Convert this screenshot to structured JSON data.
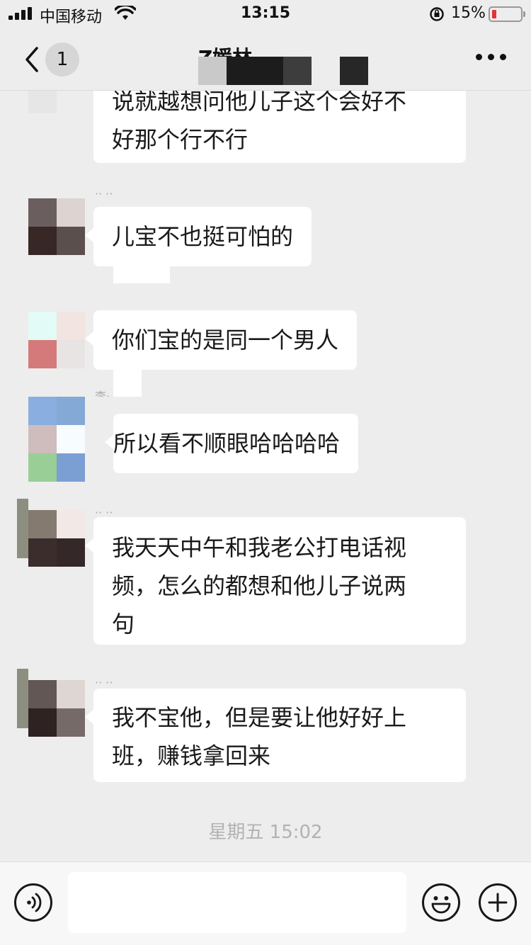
{
  "status_bar": {
    "carrier": "中国移动",
    "time": "13:15",
    "battery_percent": "15%",
    "battery_level": 0.15,
    "battery_color": "#e33333"
  },
  "nav": {
    "back_icon": "chevron-left-icon",
    "unread_count": "1",
    "title_partial": "Z媛林",
    "more_icon": "more-dots-icon"
  },
  "messages": [
    {
      "text": "说就越想问他儿子这个会好不好那个行不行",
      "lines": [
        "说就越想问他儿子这个会好不",
        "好那个行不行"
      ]
    },
    {
      "text": "儿宝不也挺可怕的"
    },
    {
      "text": "你们宝的是同一个男人"
    },
    {
      "text": "所以看不顺眼哈哈哈哈"
    },
    {
      "text": "我天天中午和我老公打电话视频，怎么的都想和他儿子说两句",
      "lines": [
        "我天天中午和我老公打电话视",
        "频，怎么的都想和他儿子说两",
        "句"
      ]
    },
    {
      "text": "我不宝他，但是要让他好好上班，赚钱拿回来",
      "lines": [
        "我不宝他，但是要让他好好上",
        "班，赚钱拿回来"
      ]
    }
  ],
  "timestamp": "星期五 15:02",
  "input_bar": {
    "voice_icon": "voice-icon",
    "emoji_icon": "emoji-icon",
    "add_icon": "plus-icon",
    "input_value": ""
  }
}
